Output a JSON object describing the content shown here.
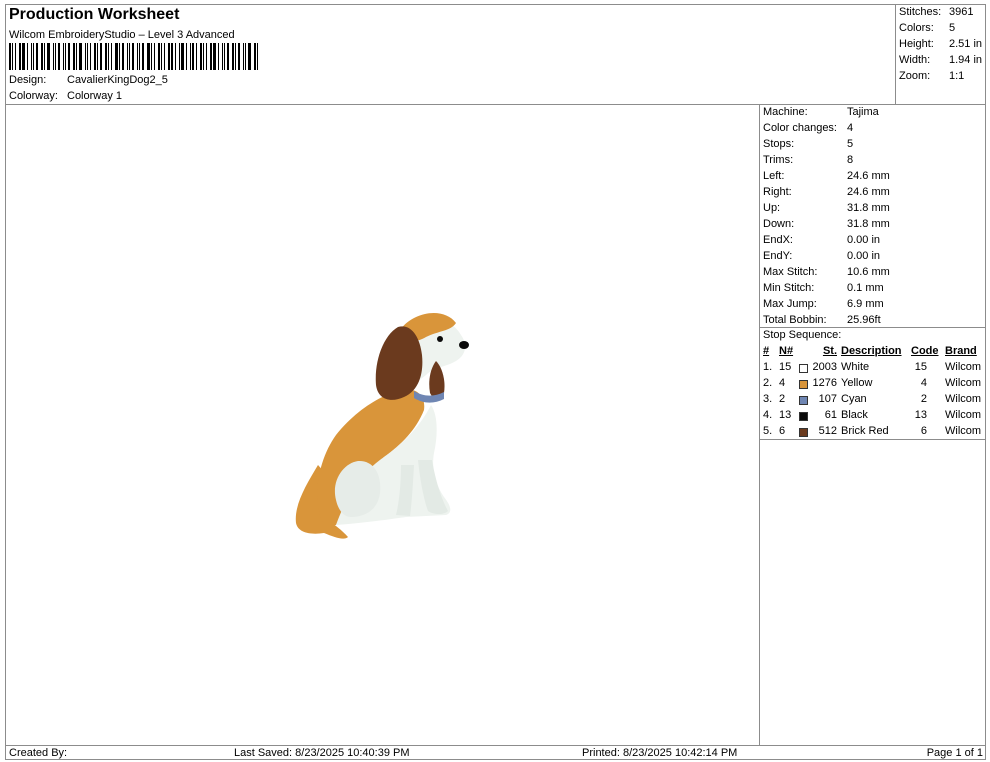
{
  "header": {
    "title": "Production Worksheet",
    "subtitle": "Wilcom EmbroideryStudio – Level 3 Advanced",
    "design_label": "Design:",
    "design_value": "CavalierKingDog2_5",
    "colorway_label": "Colorway:",
    "colorway_value": "Colorway 1"
  },
  "summary": {
    "stitches_label": "Stitches:",
    "stitches": "3961",
    "colors_label": "Colors:",
    "colors": "5",
    "height_label": "Height:",
    "height": "2.51 in",
    "width_label": "Width:",
    "width": "1.94 in",
    "zoom_label": "Zoom:",
    "zoom": "1:1"
  },
  "info": [
    {
      "label": "Machine:",
      "value": "Tajima"
    },
    {
      "label": "Color changes:",
      "value": "4"
    },
    {
      "label": "Stops:",
      "value": "5"
    },
    {
      "label": "Trims:",
      "value": "8"
    },
    {
      "label": "Left:",
      "value": "24.6 mm"
    },
    {
      "label": "Right:",
      "value": "24.6 mm"
    },
    {
      "label": "Up:",
      "value": "31.8 mm"
    },
    {
      "label": "Down:",
      "value": "31.8 mm"
    },
    {
      "label": "EndX:",
      "value": "0.00 in"
    },
    {
      "label": "EndY:",
      "value": "0.00 in"
    },
    {
      "label": "Max Stitch:",
      "value": "10.6 mm"
    },
    {
      "label": "Min Stitch:",
      "value": "0.1 mm"
    },
    {
      "label": "Max Jump:",
      "value": "6.9 mm"
    },
    {
      "label": "Total Bobbin:",
      "value": "25.96ft"
    }
  ],
  "stop_sequence": {
    "title": "Stop Sequence:",
    "headers": {
      "num": "#",
      "n": "N#",
      "st": "St.",
      "description": "Description",
      "code": "Code",
      "brand": "Brand"
    },
    "rows": [
      {
        "num": "1.",
        "n": "15",
        "st": "2003",
        "description": "White",
        "code": "15",
        "brand": "Wilcom",
        "color": "#ffffff"
      },
      {
        "num": "2.",
        "n": "4",
        "st": "1276",
        "description": "Yellow",
        "code": "4",
        "brand": "Wilcom",
        "color": "#d9953a"
      },
      {
        "num": "3.",
        "n": "2",
        "st": "107",
        "description": "Cyan",
        "code": "2",
        "brand": "Wilcom",
        "color": "#6f86b3"
      },
      {
        "num": "4.",
        "n": "13",
        "st": "61",
        "description": "Black",
        "code": "13",
        "brand": "Wilcom",
        "color": "#0a0a0a"
      },
      {
        "num": "5.",
        "n": "6",
        "st": "512",
        "description": "Brick Red",
        "code": "6",
        "brand": "Wilcom",
        "color": "#6b3a1e"
      }
    ]
  },
  "footer": {
    "created_by": "Created By:",
    "last_saved": "Last Saved: 8/23/2025 10:40:39 PM",
    "printed": "Printed: 8/23/2025 10:42:14 PM",
    "page": "Page 1 of 1"
  }
}
